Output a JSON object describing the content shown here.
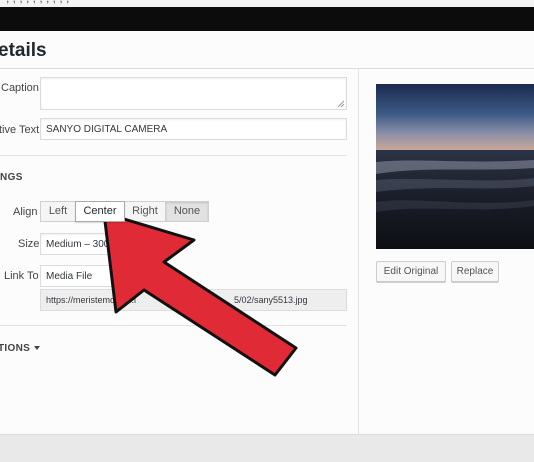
{
  "window": {
    "top_strip_text": "; , , , , , , , , ,"
  },
  "modal": {
    "title": "etails"
  },
  "fields": {
    "caption_label": "Caption",
    "caption_value": "",
    "alt_label": "tive Text",
    "alt_value": "SANYO DIGITAL CAMERA"
  },
  "settings": {
    "heading": "NGS",
    "align_label": "Align",
    "align_options": [
      "Left",
      "Center",
      "Right",
      "None"
    ],
    "align_selected": "Center",
    "size_label": "Size",
    "size_value": "Medium – 300 × 2",
    "link_label": "Link To",
    "link_value": "Media File",
    "url_left": "https://meristemolabs.i",
    "url_right": "5/02/sany5513.jpg",
    "advanced_label": "TIONS"
  },
  "sidebar": {
    "edit_original_label": "Edit Original",
    "replace_label": "Replace"
  },
  "colors": {
    "arrow_fill": "#e02a36",
    "arrow_stroke": "#111111",
    "dark_bar": "#0c0c0c"
  },
  "icons": {
    "pointer": "big-red-arrow-icon",
    "select_arrows": "chevron-down-icon",
    "resize": "resize-grip-icon"
  }
}
